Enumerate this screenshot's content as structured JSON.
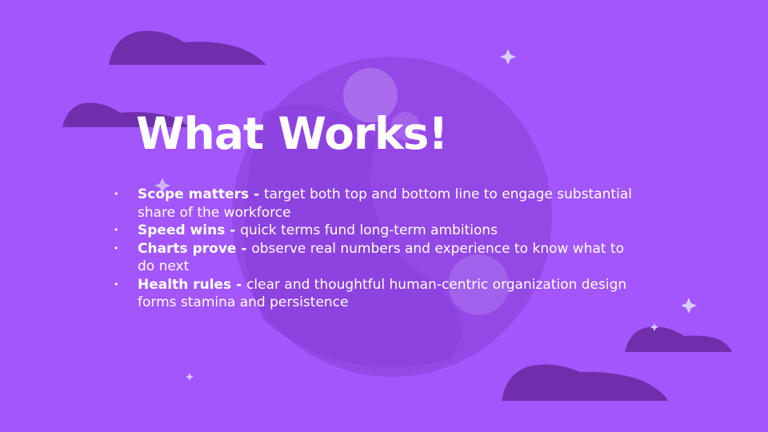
{
  "slide": {
    "title": "What Works!",
    "bullets": [
      {
        "head": "Scope matters - ",
        "text": "target both top and bottom line to engage substantial share of the workforce"
      },
      {
        "head": "Speed wins - ",
        "text": "quick terms fund long-term ambitions"
      },
      {
        "head": "Charts prove - ",
        "text": "observe real numbers and experience to know what to do next"
      },
      {
        "head": "Health rules - ",
        "text": "clear and thoughtful human-centric organization design forms stamina and persistence"
      }
    ],
    "bullet_symbol": "•"
  },
  "colors": {
    "background": "#a256fb",
    "planet": "#9448e6",
    "planet_shade": "#8a41dc",
    "crater": "#ad76ee",
    "cloud": "#6f2fad",
    "sparkle": "#d9cbff",
    "text": "#ffffff"
  }
}
